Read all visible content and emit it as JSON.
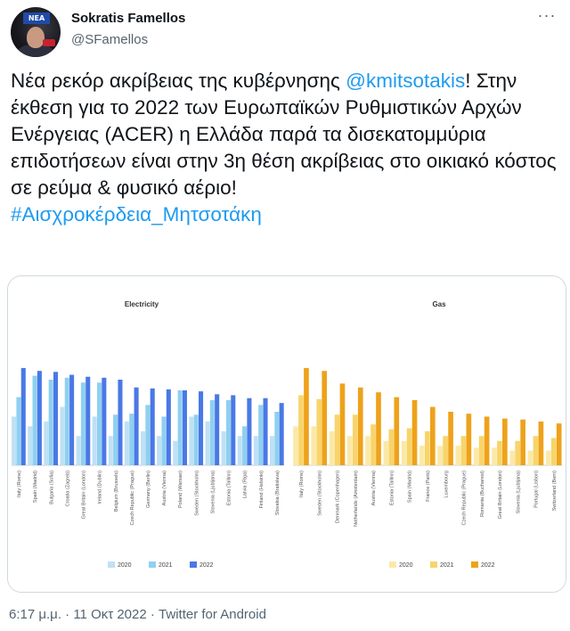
{
  "author": {
    "name": "Sokratis Famellos",
    "handle": "@SFamellos",
    "avatar_logo_text": "ΝΕΑ"
  },
  "tweet": {
    "text_before": "Νέα ρεκόρ ακρίβειας της κυβέρνησης ",
    "mention": "@kmitsotakis",
    "text_after": "! Στην έκθεση για το 2022 των Ευρωπαϊκών Ρυθμιστικών Αρχών Ενέργειας (ACER) η Ελλάδα παρά τα δισεκατομμύρια επιδοτήσεων είναι στην 3η θέση ακρίβειας στο οικιακό κόστος σε ρεύμα & φυσικό αέριο!",
    "hashtag": "#Αισχροκέρδεια_Μητσοτάκη"
  },
  "meta": {
    "time": "6:17 μ.μ.",
    "separator": " · ",
    "date": "11 Οκτ 2022",
    "client": "Twitter for Android"
  },
  "colors": {
    "electricity": [
      "#bfe0f5",
      "#8fd0f0",
      "#4a78e6"
    ],
    "gas": [
      "#fbe9a8",
      "#f8d46a",
      "#eea21a"
    ]
  },
  "chart_data": [
    {
      "type": "bar",
      "title": "Electricity",
      "categories": [
        "Italy (Rome)",
        "Spain (Madrid)",
        "Bulgaria (Sofia)",
        "Croatia (Zagreb)",
        "Great Britain (London)",
        "Ireland (Dublin)",
        "Belgium (Brussels)",
        "Czech Republic (Prague)",
        "Germany (Berlin)",
        "Austria (Vienna)",
        "Poland (Warsaw)",
        "Sweden (Stockholm)",
        "Slovenia (Ljubljana)",
        "Estonia (Tallinn)",
        "Latvia (Riga)",
        "Finland (Helsinki)",
        "Slovakia (Bratislava)"
      ],
      "series": [
        {
          "name": "2020",
          "values": [
            50,
            40,
            45,
            60,
            30,
            50,
            30,
            45,
            35,
            30,
            25,
            50,
            45,
            35,
            30,
            30,
            30
          ]
        },
        {
          "name": "2021",
          "values": [
            70,
            92,
            88,
            90,
            85,
            85,
            52,
            53,
            62,
            50,
            77,
            52,
            67,
            67,
            40,
            62,
            55
          ]
        },
        {
          "name": "2022",
          "values": [
            100,
            97,
            96,
            93,
            91,
            90,
            88,
            80,
            79,
            78,
            77,
            76,
            73,
            72,
            69,
            69,
            64
          ]
        }
      ],
      "ylim": [
        0,
        110
      ]
    },
    {
      "type": "bar",
      "title": "Gas",
      "categories": [
        "Italy (Rome)",
        "Sweden (Stockholm)",
        "Denmark (Copenhagen)",
        "Netherlands (Amsterdam)",
        "Austria (Vienna)",
        "Estonia (Tallinn)",
        "Spain (Madrid)",
        "France (Paris)",
        "Luxembourg",
        "Czech Republic (Prague)",
        "Romania (Bucharest)",
        "Great Britain (London)",
        "Slovenia (Ljubljana)",
        "Portugal (Lisbon)",
        "Switzerland (Bern)"
      ],
      "series": [
        {
          "name": "2020",
          "values": [
            40,
            40,
            35,
            30,
            30,
            25,
            25,
            20,
            20,
            20,
            18,
            18,
            15,
            15,
            15
          ]
        },
        {
          "name": "2021",
          "values": [
            72,
            68,
            52,
            52,
            42,
            37,
            38,
            35,
            30,
            30,
            30,
            25,
            25,
            30,
            28
          ]
        },
        {
          "name": "2022",
          "values": [
            100,
            97,
            84,
            80,
            75,
            70,
            67,
            60,
            55,
            53,
            50,
            48,
            47,
            45,
            43
          ]
        }
      ],
      "ylim": [
        0,
        110
      ]
    }
  ]
}
